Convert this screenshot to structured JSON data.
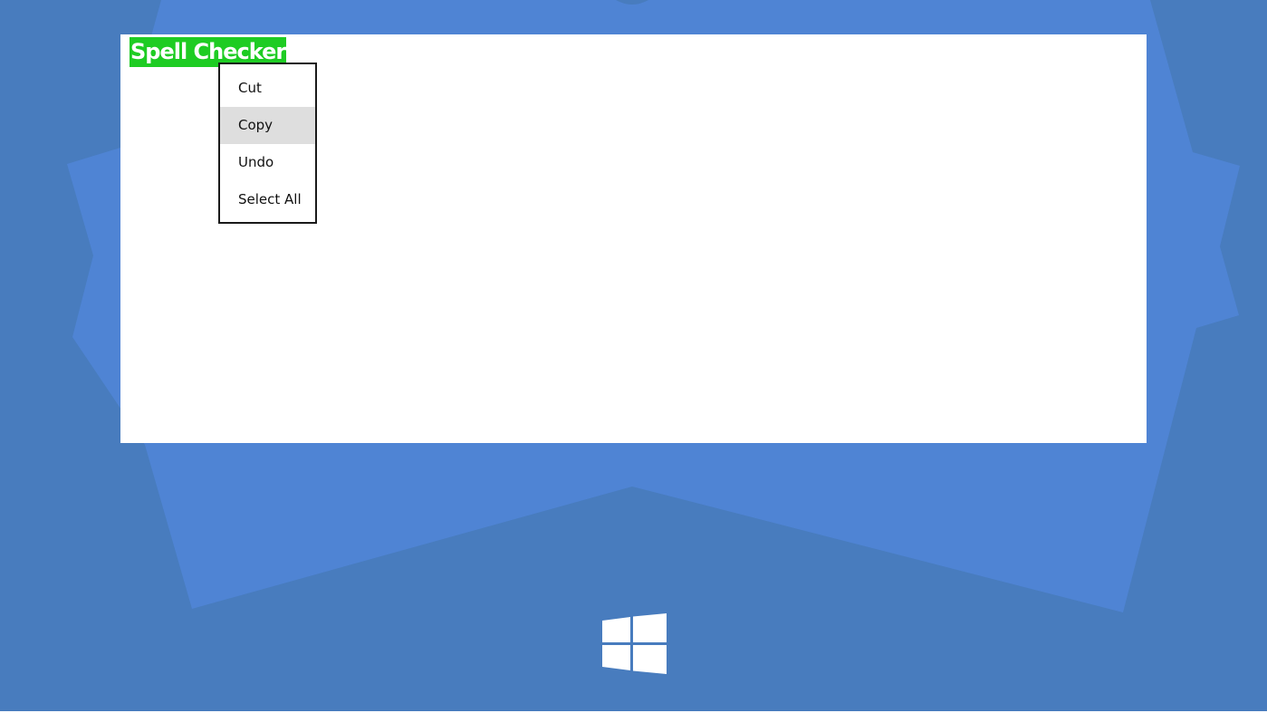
{
  "colors": {
    "desktop_outer": "#487CBE",
    "desktop_inner": "#4F84D4",
    "window_background": "#FFFFFF",
    "selection_highlight": "#1ECC23",
    "menu_hover": "#DEDEDE",
    "menu_border": "#1A1A1A",
    "logo": "#FFFFFF"
  },
  "app": {
    "selected_text": "Spell Checker"
  },
  "context_menu": {
    "highlighted_item": "Copy",
    "items": [
      {
        "label": "Cut"
      },
      {
        "label": "Copy"
      },
      {
        "label": "Undo"
      },
      {
        "label": "Select All"
      }
    ]
  },
  "splash": {
    "logo_icon": "windows-logo-icon"
  }
}
